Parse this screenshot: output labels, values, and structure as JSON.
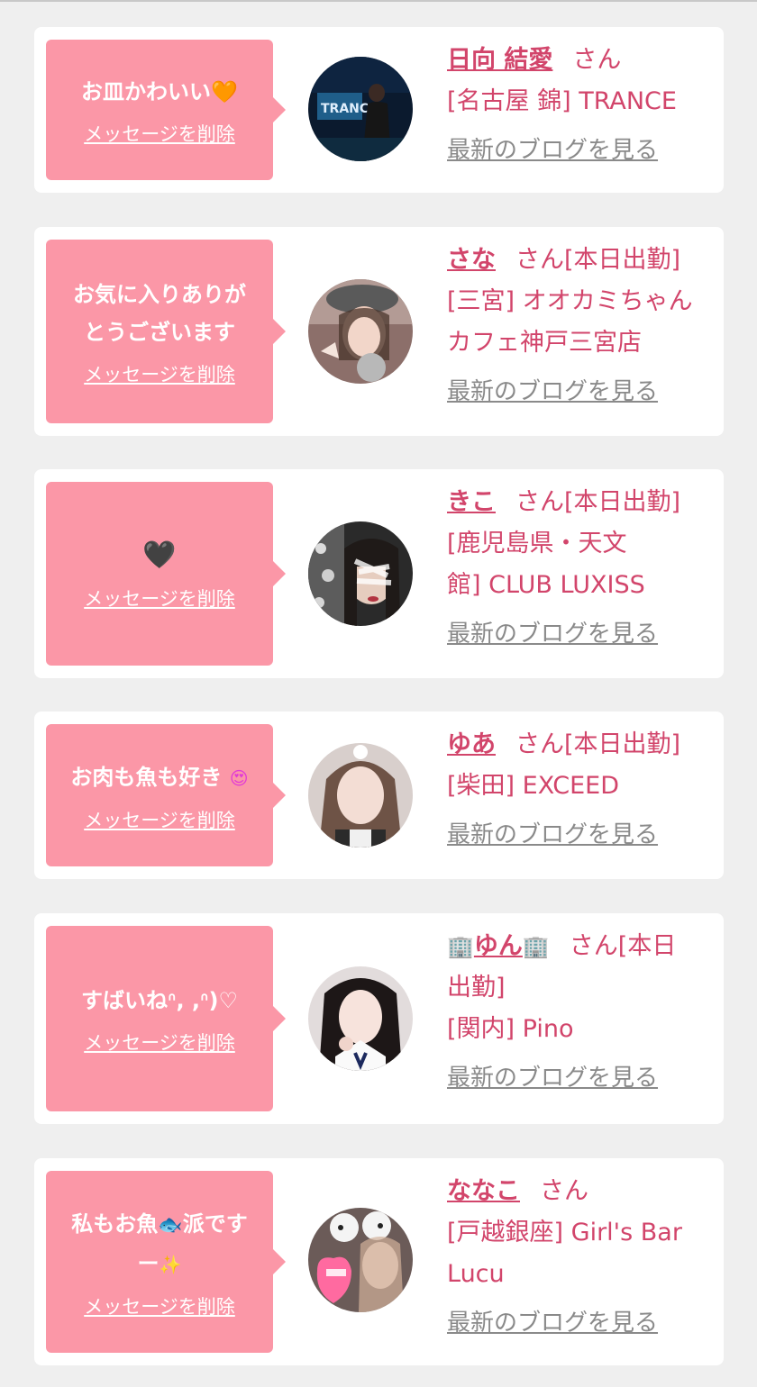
{
  "delete_label": "メッセージを削除",
  "blog_label": "最新のブログを見る",
  "honorific": "さん",
  "cards": [
    {
      "message": "お皿かわいい",
      "message_emoji": "orange-heart",
      "name": "日向 結愛",
      "status": "",
      "shop": "[名古屋 錦] TRANCE",
      "avatar_desc": "photo-avatar"
    },
    {
      "message_lines": [
        "お気に入りありが",
        "とうございます"
      ],
      "name": "さな",
      "status": "[本日出勤]",
      "shop_lines": [
        "[三宮] オオカミちゃん",
        "カフェ神戸三宮店"
      ]
    },
    {
      "message_emoji": "black-heart",
      "name": "きこ",
      "status": "[本日出勤]",
      "shop_lines": [
        "[鹿児島県・天文",
        "館] CLUB LUXISS"
      ]
    },
    {
      "message": "お肉も魚も好き",
      "message_emoji": "heart-eyes",
      "name": "ゆあ",
      "status": "[本日出勤]",
      "shop": "[柴田] EXCEED"
    },
    {
      "message": "すばいねᐢ, ,ᐢ)♡",
      "name": "ゆん",
      "name_decor": "building-emoji",
      "status_line1": "[本日",
      "status_line2": "出勤]",
      "shop": "[関内] Pino"
    },
    {
      "message_line1": "私もお魚",
      "message_line1b": "派です",
      "message_line2": "ー",
      "message_emoji": "fish, sparkles",
      "name": "ななこ",
      "status": "",
      "shop_lines": [
        "[戸越銀座] Girl's Bar",
        "Lucu"
      ]
    }
  ],
  "icons": {
    "orange_heart": "🧡",
    "black_heart": "🖤",
    "heart_eyes": "😍",
    "fish": "🐟",
    "sparkles": "✨",
    "building": "🏢"
  }
}
